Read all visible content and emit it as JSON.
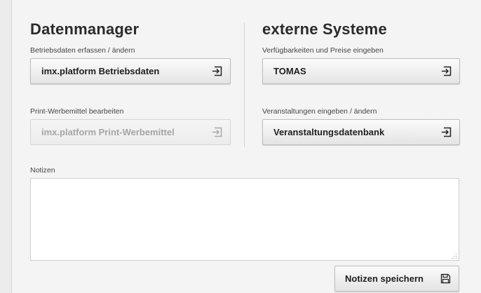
{
  "datenmanager": {
    "title": "Datenmanager",
    "betriebsdaten_label": "Betriebsdaten erfassen / ändern",
    "betriebsdaten_button": "imx.platform Betriebsdaten",
    "print_label": "Print-Werbemittel bearbeiten",
    "print_button": "imx.platform Print-Werbemittel"
  },
  "externe": {
    "title": "externe Systeme",
    "verfuegbarkeit_label": "Verfügbarkeiten und Preise eingeben",
    "tomas_button": "TOMAS",
    "veranstaltung_label": "Veranstaltungen eingeben / ändern",
    "veranstaltung_button": "Veranstaltungsdatenbank"
  },
  "notizen": {
    "label": "Notizen",
    "value": "",
    "save_button": "Notizen speichern"
  },
  "icons": {
    "open": "enter-arrow-icon",
    "save": "floppy-disk-icon"
  }
}
